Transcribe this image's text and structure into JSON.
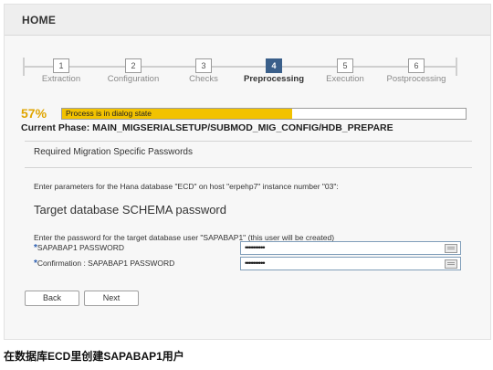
{
  "header": {
    "title": "HOME"
  },
  "stepper": {
    "steps": [
      {
        "number": "1",
        "label": "Extraction"
      },
      {
        "number": "2",
        "label": "Configuration"
      },
      {
        "number": "3",
        "label": "Checks"
      },
      {
        "number": "4",
        "label": "Preprocessing"
      },
      {
        "number": "5",
        "label": "Execution"
      },
      {
        "number": "6",
        "label": "Postprocessing"
      }
    ],
    "active_step": 4
  },
  "progress": {
    "percent_label": "57%",
    "value": 0.57,
    "status_text": "Process is in dialog state",
    "fill_color": "#f2c200"
  },
  "phase": {
    "text": "Current Phase: MAIN_MIGSERIALSETUP/SUBMOD_MIG_CONFIG/HDB_PREPARE"
  },
  "section": {
    "title": "Required Migration Specific Passwords"
  },
  "form": {
    "param_text": "Enter parameters for the Hana database \"ECD\" on host \"erpehp7\" instance number \"03\":",
    "target_title": "Target database SCHEMA password",
    "password_info": "Enter the password for the target database user \"SAPABAP1\" (this user will be created)",
    "required_marker": "*",
    "fields": [
      {
        "label": "SAPABAP1 PASSWORD",
        "value": "••••••••••"
      },
      {
        "label": "Confirmation : SAPABAP1 PASSWORD",
        "value": "••••••••••"
      }
    ]
  },
  "buttons": {
    "back": "Back",
    "next": "Next"
  },
  "caption": {
    "text": "在数据库ECD里创建SAPABAP1用户"
  },
  "colors": {
    "accent": "#3a5f8a",
    "percent": "#e0a500",
    "required": "#2a5db0"
  }
}
